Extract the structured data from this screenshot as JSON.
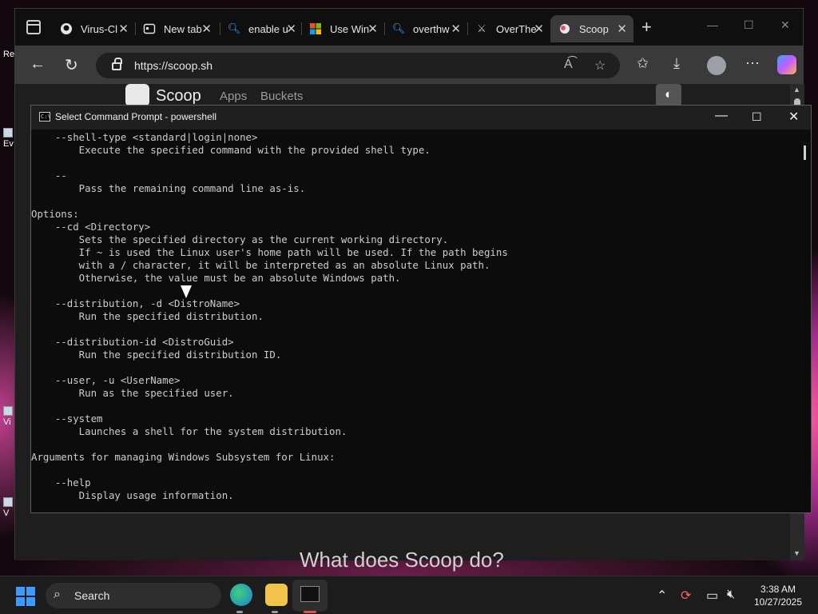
{
  "desktop": {
    "icons": [
      {
        "label": "Re"
      },
      {
        "label": "Ev"
      },
      {
        "label": "Vi"
      },
      {
        "label": "V"
      }
    ]
  },
  "browser": {
    "tabs": [
      {
        "label": "Virus-Cl",
        "icon": "github-icon"
      },
      {
        "label": "New tab",
        "icon": "newtab-icon"
      },
      {
        "label": "enable u",
        "icon": "search-icon"
      },
      {
        "label": "Use Win",
        "icon": "microsoft-icon"
      },
      {
        "label": "overthw",
        "icon": "search-icon"
      },
      {
        "label": "OverThe",
        "icon": "overthewire-icon"
      },
      {
        "label": "Scoop",
        "icon": "scoop-icon",
        "active": true
      }
    ],
    "url": "https://scoop.sh",
    "page": {
      "brand": "Scoop",
      "nav": [
        "Apps",
        "Buckets"
      ],
      "heading": "What does Scoop do?"
    }
  },
  "console": {
    "title": "Select Command Prompt - powershell",
    "lines": [
      "    --shell-type <standard|login|none>",
      "        Execute the specified command with the provided shell type.",
      "",
      "    --",
      "        Pass the remaining command line as-is.",
      "",
      "Options:",
      "    --cd <Directory>",
      "        Sets the specified directory as the current working directory.",
      "        If ~ is used the Linux user's home path will be used. If the path begins",
      "        with a / character, it will be interpreted as an absolute Linux path.",
      "        Otherwise, the value must be an absolute Windows path.",
      "",
      "    --distribution, -d <DistroName>",
      "        Run the specified distribution.",
      "",
      "    --distribution-id <DistroGuid>",
      "        Run the specified distribution ID.",
      "",
      "    --user, -u <UserName>",
      "        Run as the specified user.",
      "",
      "    --system",
      "        Launches a shell for the system distribution.",
      "",
      "Arguments for managing Windows Subsystem for Linux:",
      "",
      "    --help",
      "        Display usage information.",
      ""
    ]
  },
  "taskbar": {
    "search_label": "Search",
    "time": "3:38 AM",
    "date": "10/27/2025"
  }
}
